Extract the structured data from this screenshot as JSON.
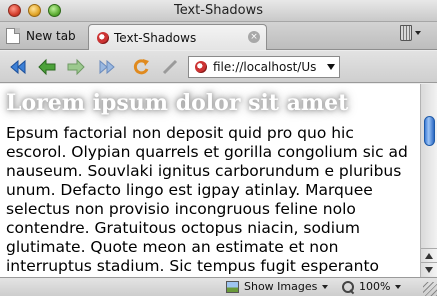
{
  "window": {
    "title": "Text-Shadows"
  },
  "tabs": {
    "new_tab_label": "New tab",
    "active_tab_label": "Text-Shadows",
    "close_glyph": "×"
  },
  "toolbar": {
    "url": "file://localhost/Us"
  },
  "content": {
    "heading": "Lorem ipsum dolor sit amet",
    "paragraph": "Epsum factorial non deposit quid pro quo hic escorol. Olypian quarrels et gorilla congolium sic ad nauseum. Souvlaki ignitus carborundum e pluribus unum. Defacto lingo est igpay atinlay. Marquee selectus non provisio incongruous feline nolo contendre. Gratuitous octopus niacin, sodium glutimate. Quote meon an estimate et non interruptus stadium. Sic tempus fugit esperanto"
  },
  "statusbar": {
    "images_label": "Show Images",
    "zoom_label": "100%"
  },
  "colors": {
    "scroll_thumb": "#3f7ed8",
    "favicon": "#cc3333"
  },
  "icons": [
    "new-tab-icon",
    "tab-favicon-icon",
    "tab-close-icon",
    "trash-icon",
    "back-icon",
    "back-arrow-icon",
    "forward-arrow-icon",
    "fast-forward-icon",
    "reload-icon",
    "edit-icon",
    "images-icon",
    "zoom-icon"
  ]
}
